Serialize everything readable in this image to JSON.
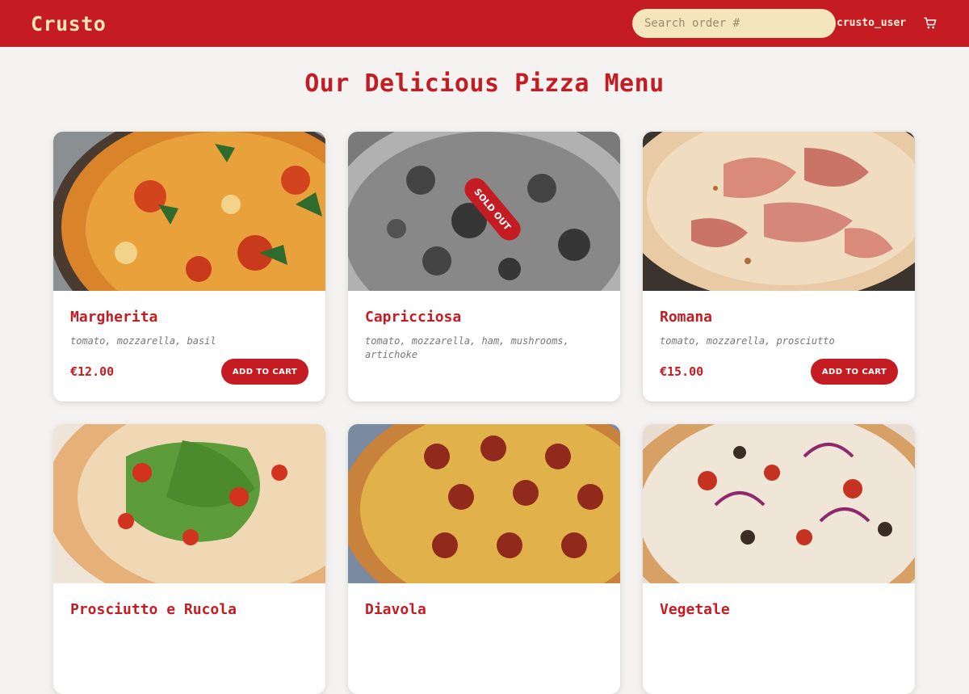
{
  "header": {
    "logo": "Crusto",
    "search_placeholder": "Search order #",
    "username": "crusto_user",
    "cart_icon": "cart-icon"
  },
  "page": {
    "title": "Our Delicious Pizza Menu"
  },
  "pizzas": [
    {
      "name": "Margherita",
      "ingredients": "tomato, mozzarella, basil",
      "price": "€12.00",
      "button": "ADD TO CART",
      "sold_out": false
    },
    {
      "name": "Capricciosa",
      "ingredients": "tomato, mozzarella, ham, mushrooms, artichoke",
      "price": "",
      "button": "",
      "sold_out": true,
      "badge": "SOLD OUT"
    },
    {
      "name": "Romana",
      "ingredients": "tomato, mozzarella, prosciutto",
      "price": "€15.00",
      "button": "ADD TO CART",
      "sold_out": false
    },
    {
      "name": "Prosciutto e Rucola"
    },
    {
      "name": "Diavola"
    },
    {
      "name": "Vegetale"
    }
  ],
  "colors": {
    "brand": "#c41c22",
    "accent": "#f3e6bd",
    "background": "#f4f3f1"
  }
}
